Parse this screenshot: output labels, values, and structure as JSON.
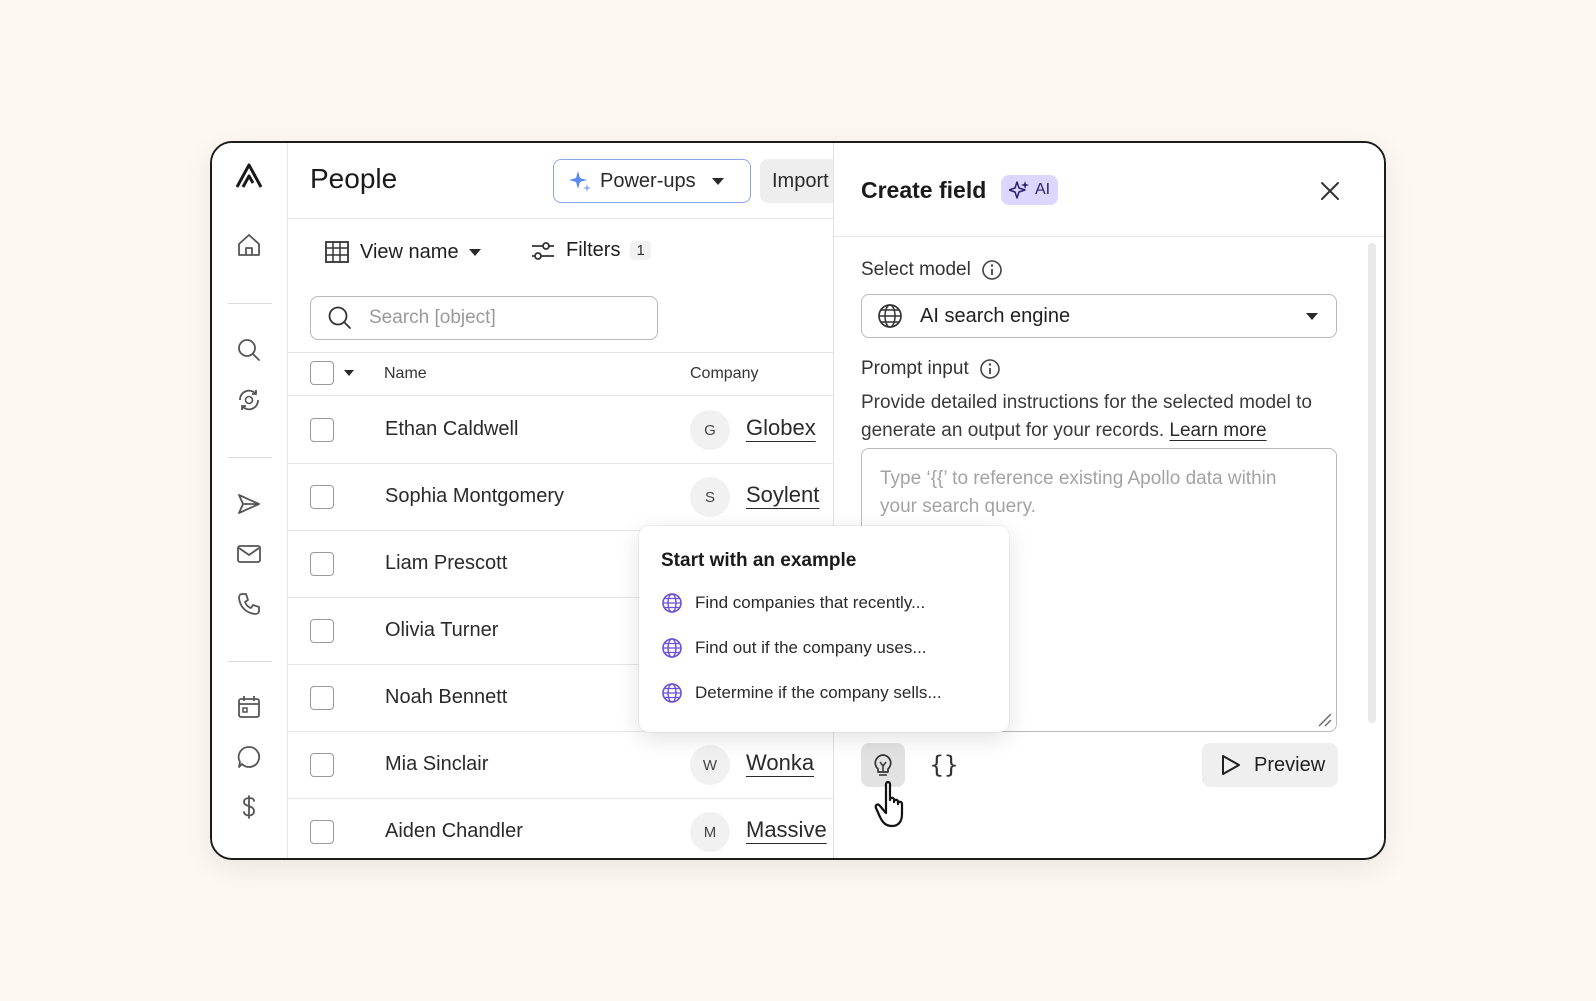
{
  "sidebar": {
    "logo": "apollo-logo",
    "icons": [
      "home-icon",
      "search-icon",
      "refresh-search-icon",
      "send-icon",
      "mail-icon",
      "phone-icon",
      "calendar-icon",
      "chat-icon",
      "dollar-icon"
    ]
  },
  "header": {
    "title": "People",
    "powerups_label": "Power-ups",
    "import_label": "Import"
  },
  "toolbar": {
    "view_label": "View name",
    "filters_label": "Filters",
    "filters_count": "1"
  },
  "search": {
    "placeholder": "Search [object]"
  },
  "table": {
    "columns": {
      "name": "Name",
      "company": "Company"
    },
    "rows": [
      {
        "name": "Ethan Caldwell",
        "initial": "G",
        "company": "Globex"
      },
      {
        "name": "Sophia Montgomery",
        "initial": "S",
        "company": "Soylent"
      },
      {
        "name": "Liam Prescott",
        "initial": "",
        "company": ""
      },
      {
        "name": "Olivia Turner",
        "initial": "",
        "company": ""
      },
      {
        "name": "Noah Bennett",
        "initial": "",
        "company": ""
      },
      {
        "name": "Mia Sinclair",
        "initial": "W",
        "company": "Wonka"
      },
      {
        "name": "Aiden Chandler",
        "initial": "M",
        "company": "Massive"
      }
    ]
  },
  "examples": {
    "title": "Start with an example",
    "items": [
      "Find companies that recently...",
      "Find out if the company uses...",
      "Determine if the company sells..."
    ]
  },
  "panel": {
    "title": "Create field",
    "badge": "AI",
    "model_label": "Select model",
    "model_value": "AI search engine",
    "prompt_label": "Prompt input",
    "prompt_desc": "Provide detailed instructions for the selected model to generate an output for your records.",
    "learn_more": "Learn more",
    "prompt_placeholder": "Type ‘{{’ to reference existing Apollo data within your search query.",
    "braces": "{}",
    "preview_label": "Preview"
  },
  "colors": {
    "accent_blue": "#8aa9ea",
    "ai_badge_bg": "#ddd6ff",
    "globe_purple": "#6b4fd8",
    "background": "#fdf8f2"
  }
}
